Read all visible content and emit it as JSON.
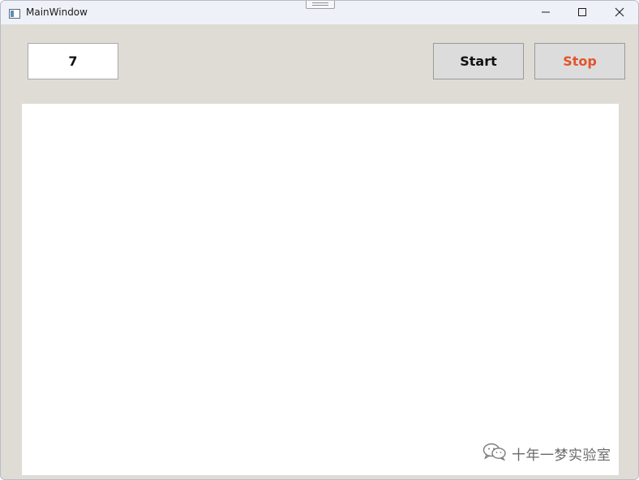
{
  "window": {
    "title": "MainWindow",
    "controls": {
      "minimize": "minimize-icon",
      "maximize": "maximize-icon",
      "close": "close-icon"
    }
  },
  "toolbar": {
    "count_value": "7",
    "start_label": "Start",
    "stop_label": "Stop"
  },
  "colors": {
    "window_bg": "#dedcd5",
    "titlebar_bg": "#eef2f8",
    "stop_text": "#e2542c",
    "button_bg": "#dcdcdc"
  },
  "watermark": {
    "icon": "wechat-icon",
    "text": "十年一梦实验室"
  }
}
